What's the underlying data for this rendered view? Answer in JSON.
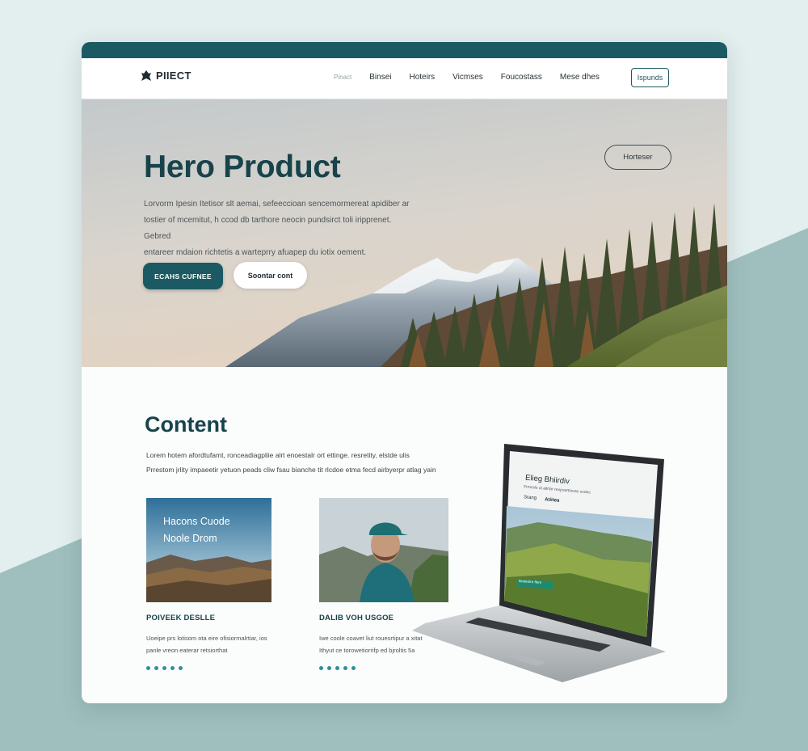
{
  "colors": {
    "accent": "#1c5a63",
    "title": "#18434b",
    "dots": "#2f8f9a"
  },
  "nav": {
    "logo": "PIIECT",
    "logo_icon": "brand-icon",
    "items": [
      "Pinact",
      "Binsei",
      "Hoteirs",
      "Vicmses",
      "Foucostass",
      "Mese dhes"
    ],
    "button": "Ispunds"
  },
  "hero": {
    "title": "Hero Product",
    "lines": [
      "Lorvorm Ipesin Itetisor slt aemai, sefeeccioan sencemormereat apidiber ar",
      "tostier of mcemitut, h ccod db tarthore neocin pundsirct toli iripprenet. Gebred",
      "entareer mdaion richtetis a warteprry afuapep du iotix oement."
    ],
    "primary_button": "ECAHS CUFNEE",
    "secondary_button": "Soontar cont",
    "pill_button": "Horteser"
  },
  "content": {
    "title": "Content",
    "lines": [
      "Lorem hotem afordtufamt, ronceadiagpliie alrt enoestalr ort ettinge. resretity, elstde ulis",
      "Prrestom jrlity impaeetir yetuon peads cliw fsau bianche tit rlcdoe etma fecd airbyerpr atlag yain"
    ],
    "cards": [
      {
        "image_text": [
          "Hacons Cuode",
          "Noole Drom"
        ],
        "title": "POIVEEK DESLLE",
        "desc": [
          "Uoeipe prs lotisom ota eire ofisiormalrtiar, ios",
          "panle vreon eaterar retsiorthat"
        ]
      },
      {
        "title": "DALIB VOH USGOE",
        "desc": [
          "Iwe coole coavet liut rouesrtipur a xitat",
          "Ithyut ce torowetiorrifp ed bjroltis 5a"
        ]
      }
    ],
    "laptop": {
      "title": "Elieg Bhiirdiv",
      "subtitle": "Frmrolo ot ailrtar reopsertiouas ocdec",
      "tags": [
        "Srang",
        "Atiitea"
      ],
      "badge": "Broteolre flere"
    }
  }
}
